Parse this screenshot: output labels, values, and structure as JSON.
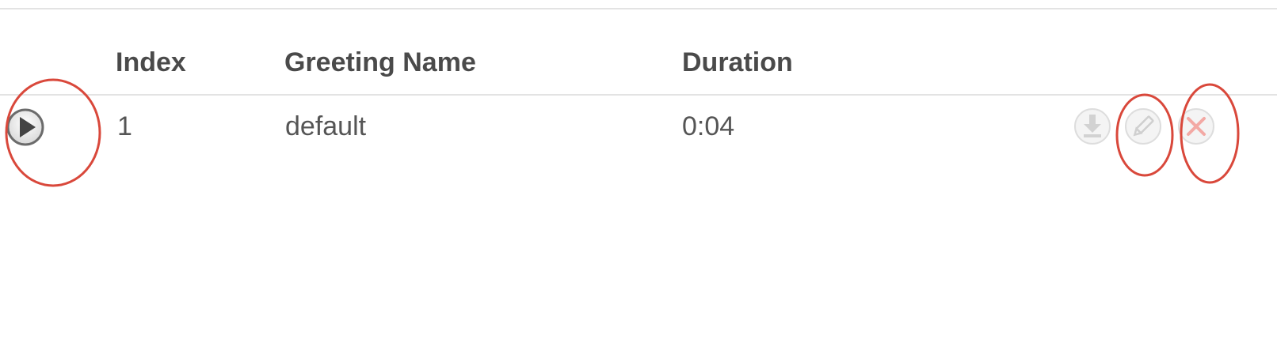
{
  "table": {
    "headers": {
      "index": "Index",
      "greeting_name": "Greeting Name",
      "duration": "Duration"
    },
    "rows": [
      {
        "index": "1",
        "greeting_name": "default",
        "duration": "0:04"
      }
    ]
  },
  "icons": {
    "play": "play-icon",
    "download": "download-icon",
    "edit": "pencil-icon",
    "delete": "close-icon"
  },
  "colors": {
    "annotation": "#d9483b",
    "header_text": "#4a4a4a",
    "cell_text": "#555555",
    "icon_disabled": "#d6d6d6",
    "delete_icon": "#f3a9a4",
    "divider": "#e3e3e3"
  }
}
